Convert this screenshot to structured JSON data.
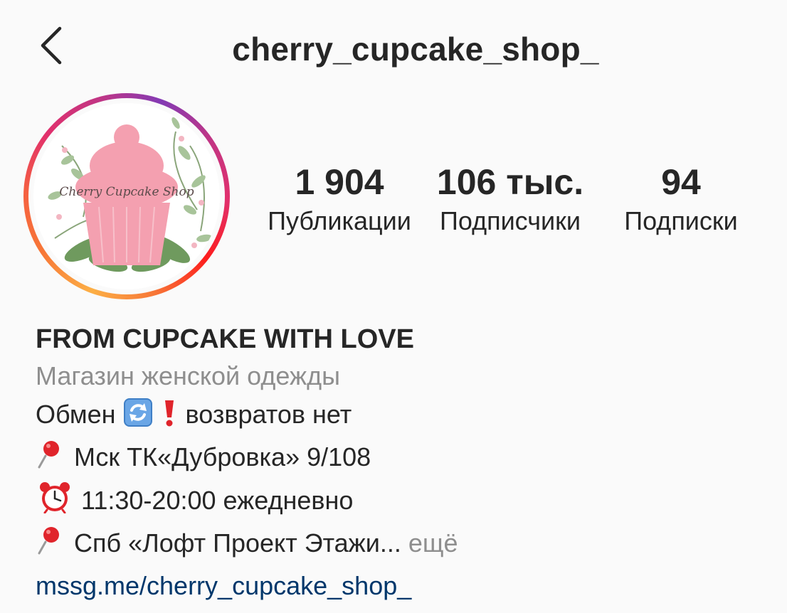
{
  "header": {
    "username": "cherry_cupcake_shop_"
  },
  "avatar": {
    "logo_text": "Cherry Cupcake Shop"
  },
  "stats": {
    "posts_value": "1 904",
    "posts_label": "Публикации",
    "followers_value": "106 тыс.",
    "followers_label": "Подписчики",
    "following_value": "94",
    "following_label": "Подписки"
  },
  "bio": {
    "name": "FROM CUPCAKE WITH LOVE",
    "category": "Магазин женской одежды",
    "line1_pre": "Обмен",
    "line1_post": "возвратов нет",
    "line2": "Мск ТК«Дубровка» 9/108",
    "line3": "11:30-20:00 ежедневно",
    "line4": "Спб «Лофт Проект Этажи...",
    "more": "ещё",
    "link": "mssg.me/cherry_cupcake_shop_"
  },
  "icons": {
    "back": "chevron-left-icon",
    "exchange": "arrows-counterclockwise-icon",
    "exclamation": "red-exclamation-icon",
    "pin": "round-pushpin-icon",
    "clock": "alarm-clock-icon"
  },
  "colors": {
    "link": "#00376b",
    "secondary_text": "#8e8e8e",
    "primary_text": "#262626",
    "cupcake_pink": "#f4a0b0"
  }
}
